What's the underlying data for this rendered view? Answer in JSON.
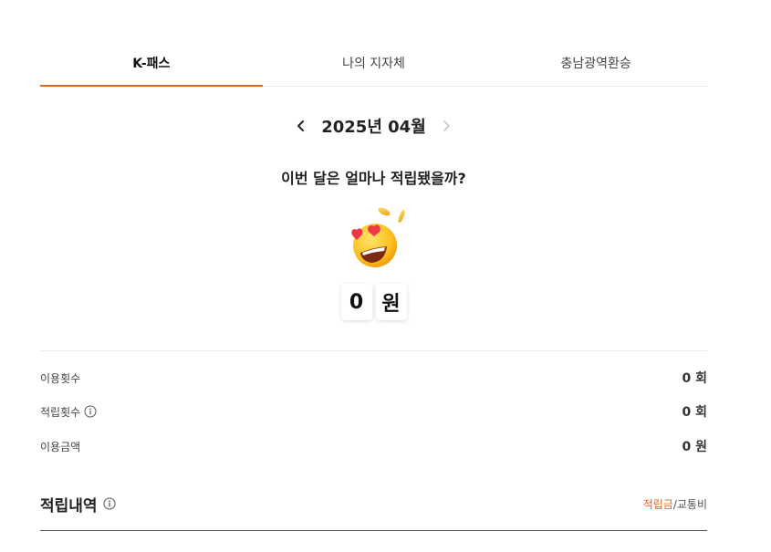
{
  "tabs": [
    {
      "label": "K-패스",
      "active": true
    },
    {
      "label": "나의 지자체",
      "active": false
    },
    {
      "label": "충남광역환승",
      "active": false
    }
  ],
  "month_nav": {
    "label": "2025년 04월",
    "prev_icon": "chevron-left-icon",
    "next_icon": "chevron-right-icon"
  },
  "summary": {
    "question": "이번 달은 얼마나 적립됐을까?",
    "emoji": "heart-eyes-coins-emoji",
    "amount_digit": "0",
    "amount_unit": "원"
  },
  "stats": [
    {
      "label": "이용횟수",
      "value": "0 회",
      "info": false
    },
    {
      "label": "적립횟수",
      "value": "0 회",
      "info": true
    },
    {
      "label": "이용금액",
      "value": "0 원",
      "info": false
    }
  ],
  "history": {
    "title": "적립내역",
    "toggle_active": "적립금",
    "toggle_separator": "/",
    "toggle_inactive": "교통비"
  },
  "colors": {
    "accent": "#e8641e",
    "text": "#222222",
    "muted": "#444444"
  }
}
